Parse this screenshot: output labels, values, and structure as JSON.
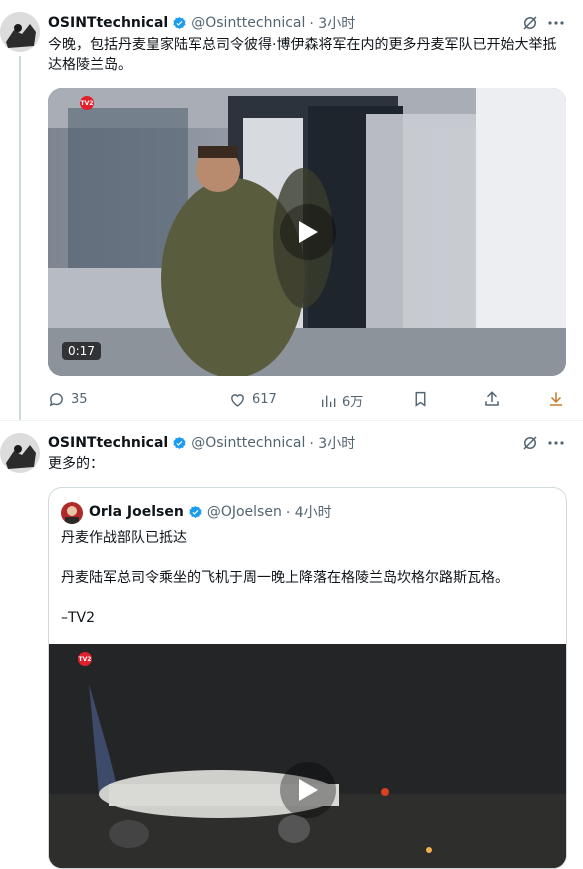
{
  "tweet1": {
    "name": "OSINTtechnical",
    "handle": "@Osinttechnical",
    "time": "· 3小时",
    "text": "今晚，包括丹麦皇家陆军总司令彼得·博伊森将军在内的更多丹麦军队已开始大举抵达格陵兰岛。",
    "video_duration": "0:17",
    "video_logo": "TV2",
    "stats": {
      "replies": "35",
      "likes": "617",
      "views": "6万"
    }
  },
  "tweet2": {
    "name": "OSINTtechnical",
    "handle": "@Osinttechnical",
    "time": "· 3小时",
    "text": "更多的："
  },
  "quote": {
    "name": "Orla Joelsen",
    "handle": "@OJoelsen",
    "time": "· 4小时",
    "line1": "丹麦作战部队已抵达",
    "line2": "丹麦陆军总司令乘坐的飞机于周一晚上降落在格陵兰岛坎格尔路斯瓦格。",
    "line3": "–TV2",
    "video_logo": "TV2"
  },
  "colors": {
    "verified": "#1d9bf0",
    "text": "#0f1419",
    "muted": "#536471",
    "download": "#c77b2a"
  },
  "icons": {
    "grok": "grok-icon",
    "more": "more-icon",
    "reply": "reply-icon",
    "like": "heart-icon",
    "views": "views-icon",
    "bookmark": "bookmark-icon",
    "share": "share-icon",
    "download": "download-icon",
    "play": "play-icon"
  }
}
